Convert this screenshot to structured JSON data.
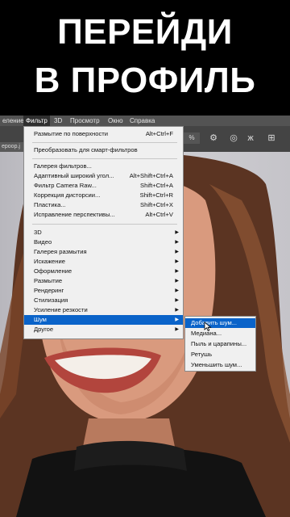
{
  "banner": {
    "line1": "ПЕРЕЙДИ",
    "line2": "В ПРОФИЛЬ"
  },
  "menubar": {
    "items": [
      "еление",
      "Фильтр",
      "3D",
      "Просмотр",
      "Окно",
      "Справка"
    ]
  },
  "optbar": {
    "tab_label": "ероор.j",
    "percent": "%"
  },
  "filter_menu": {
    "group1": [
      {
        "label": "Размытие по поверхности",
        "shortcut": "Alt+Ctrl+F"
      }
    ],
    "group2": [
      {
        "label": "Преобразовать для смарт-фильтров",
        "shortcut": ""
      }
    ],
    "group3": [
      {
        "label": "Галерея фильтров...",
        "shortcut": ""
      },
      {
        "label": "Адаптивный широкий угол...",
        "shortcut": "Alt+Shift+Ctrl+A"
      },
      {
        "label": "Фильтр Camera Raw...",
        "shortcut": "Shift+Ctrl+A"
      },
      {
        "label": "Коррекция дисторсии...",
        "shortcut": "Shift+Ctrl+R"
      },
      {
        "label": "Пластика...",
        "shortcut": "Shift+Ctrl+X"
      },
      {
        "label": "Исправление перспективы...",
        "shortcut": "Alt+Ctrl+V"
      }
    ],
    "group4": [
      {
        "label": "3D"
      },
      {
        "label": "Видео"
      },
      {
        "label": "Галерея размытия"
      },
      {
        "label": "Искажение"
      },
      {
        "label": "Оформление"
      },
      {
        "label": "Размытие"
      },
      {
        "label": "Рендеринг"
      },
      {
        "label": "Стилизация"
      },
      {
        "label": "Усиление резкости"
      },
      {
        "label": "Шум"
      },
      {
        "label": "Другое"
      }
    ]
  },
  "noise_submenu": {
    "items": [
      "Добавить шум...",
      "Медиана...",
      "Пыль и царапины...",
      "Ретушь",
      "Уменьшить шум..."
    ]
  },
  "colors": {
    "highlight": "#0a63c9",
    "menu_bg": "#f0f0f0",
    "menubar_bg": "#535353"
  }
}
